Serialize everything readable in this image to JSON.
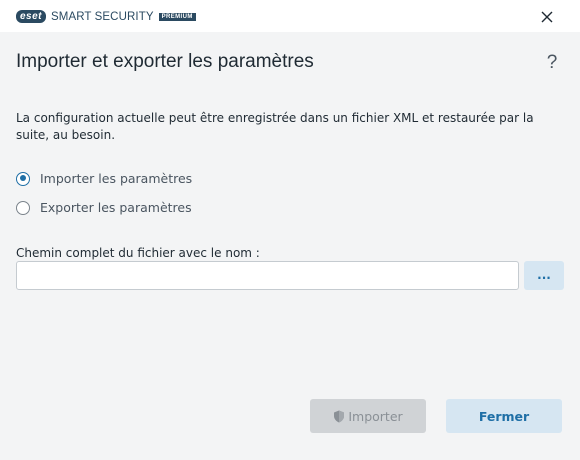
{
  "app": {
    "brand_badge": "eset",
    "product_name": "SMART SECURITY",
    "edition_badge": "PREMIUM"
  },
  "window": {
    "close_icon": "close-icon"
  },
  "dialog": {
    "title": "Importer et exporter les paramètres",
    "help_label": "?",
    "description": "La configuration actuelle peut être enregistrée dans un fichier XML et restaurée par la suite, au besoin.",
    "options": [
      {
        "label": "Importer les paramètres",
        "selected": true
      },
      {
        "label": "Exporter les paramètres",
        "selected": false
      }
    ],
    "path_field": {
      "label": "Chemin complet du fichier avec le nom :",
      "value": "",
      "placeholder": ""
    },
    "browse_label": "...",
    "import_label": "Importer",
    "import_enabled": false,
    "close_label": "Fermer"
  },
  "colors": {
    "accent": "#1f6fa6",
    "brand": "#2b4a61",
    "background": "#f3f4f5",
    "disabled_button": "#d0d3d6",
    "secondary_button": "#d6e6f2"
  }
}
